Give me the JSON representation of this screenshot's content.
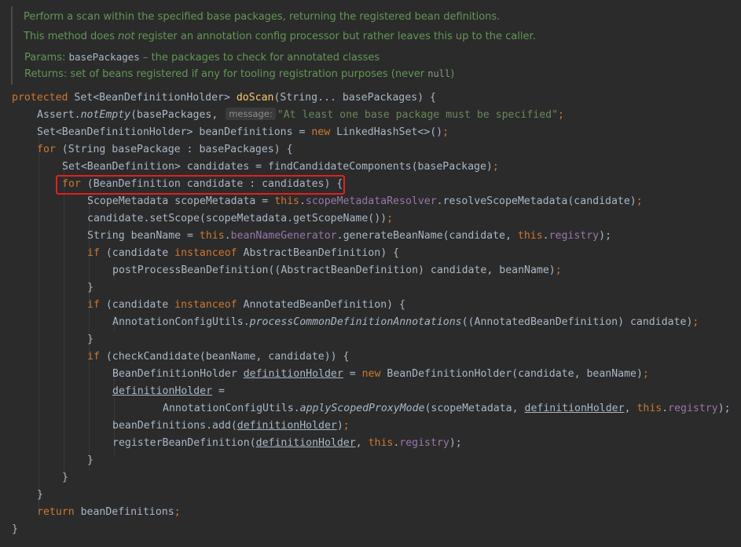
{
  "javadoc": {
    "summary": "Perform a scan within the specified base packages, returning the registered bean definitions.",
    "note_pre": "This method does ",
    "note_em": "not",
    "note_post": " register an annotation config processor but rather leaves this up to the caller.",
    "params_label": "Params:",
    "params_name": "basePackages",
    "params_desc": " – the packages to check for annotated classes",
    "returns_label": "Returns:",
    "returns_desc": "set of beans registered if any for tooling registration purposes (never ",
    "returns_null": "null",
    "returns_end": ")"
  },
  "code": {
    "l1": {
      "a": "protected",
      "b": " Set<BeanDefinitionHolder> ",
      "c": "doScan",
      "d": "(String... basePackages) {"
    },
    "l2": {
      "a": "Assert.",
      "b": "notEmpty",
      "c": "(basePackages, ",
      "hint": "message:",
      "d": "\"At least one base package must be specified\"",
      "e": ";"
    },
    "l3": {
      "a": "Set<BeanDefinitionHolder> beanDefinitions = ",
      "b": "new",
      " c": " LinkedHashSet<>()",
      "d": ";"
    },
    "l4": {
      "a": "for",
      " b": " (String basePackage : basePackages) {"
    },
    "l5": {
      "a": "Set<BeanDefinition> candidates = findCandidateComponents(basePackage)",
      "b": ";"
    },
    "l6": {
      "a": "for",
      "b": " (BeanDefinition candidate : candidates) {"
    },
    "l7": {
      "a": "ScopeMetadata scopeMetadata = ",
      "b": "this",
      ".c": ".",
      "d": "scopeMetadataResolver",
      "e": ".resolveScopeMetadata(candidate)",
      "f": ";"
    },
    "l8": {
      "a": "candidate.setScope(scopeMetadata.getScopeName())",
      "b": ";"
    },
    "l9": {
      "a": "String beanName = ",
      "b": "this",
      "c": ".",
      "d": "beanNameGenerator",
      "e": ".generateBeanName(candidate, ",
      "f": "this",
      "g": ".",
      "h": "registry",
      "i": ");"
    },
    "l10": {
      "a": "if",
      "b": " (candidate ",
      "c": "instanceof",
      "d": " AbstractBeanDefinition) {"
    },
    "l11": {
      "a": "postProcessBeanDefinition((AbstractBeanDefinition) candidate, beanName)",
      "b": ";"
    },
    "l12": {
      "a": "}"
    },
    "l13": {
      "a": "if",
      "b": " (candidate ",
      "c": "instanceof",
      "d": " AnnotatedBeanDefinition) {"
    },
    "l14": {
      "a": "AnnotationConfigUtils.",
      "b": "processCommonDefinitionAnnotations",
      "c": "((AnnotatedBeanDefinition) candidate)",
      "d": ";"
    },
    "l15": {
      "a": "}"
    },
    "l16": {
      "a": "if",
      "b": " (checkCandidate(beanName, candidate)) {"
    },
    "l17": {
      "a": "BeanDefinitionHolder ",
      "b": "definitionHolder",
      "c": " = ",
      "d": "new",
      "e": " BeanDefinitionHolder(candidate, beanName)",
      "f": ";"
    },
    "l18": {
      "a": "definitionHolder",
      "b": " ="
    },
    "l19": {
      "a": "AnnotationConfigUtils.",
      "b": "applyScopedProxyMode",
      "c": "(scopeMetadata, ",
      "d": "definitionHolder",
      "e": ", ",
      "f": "this",
      "g": ".",
      "h": "registry",
      "i": ");"
    },
    "l20": {
      "a": "beanDefinitions.add(",
      "b": "definitionHolder",
      "c": ")",
      "d": ";"
    },
    "l21": {
      "a": "registerBeanDefinition(",
      "b": "definitionHolder",
      "c": ", ",
      "d": "this",
      "e": ".",
      "f": "registry",
      "g": ");"
    },
    "l22": {
      "a": "}"
    },
    "l23": {
      "a": "}"
    },
    "l24": {
      "a": "}"
    },
    "l25": {
      "a": "return",
      "b": " beanDefinitions",
      "c": ";"
    },
    "l26": {
      "a": "}"
    }
  },
  "colors": {
    "background": "#2b2b2b",
    "keyword": "#cc7832",
    "method_decl": "#ffc66d",
    "string": "#6a8759",
    "field": "#9876aa",
    "javadoc": "#629755",
    "highlight_box": "#e02020"
  }
}
